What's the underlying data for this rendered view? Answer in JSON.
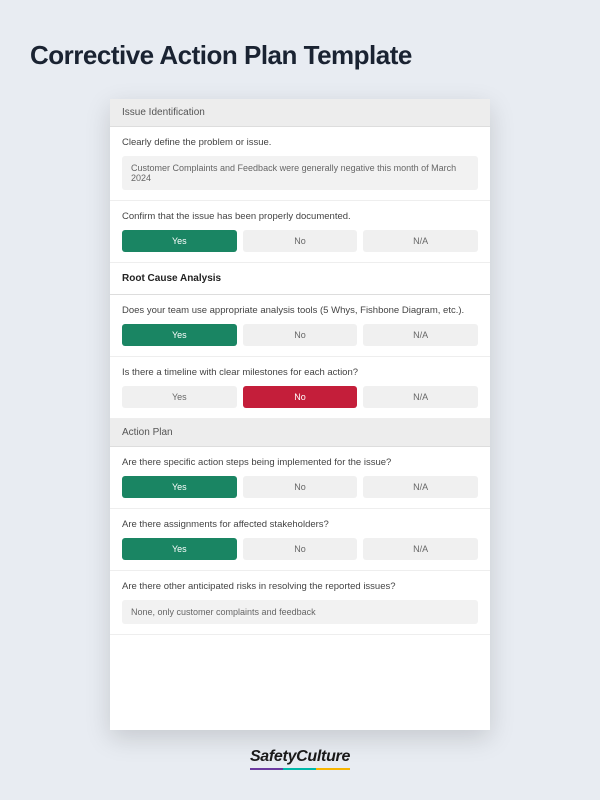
{
  "title": "Corrective Action Plan Template",
  "sections": {
    "issue_identification": {
      "header": "Issue Identification",
      "q1": {
        "text": "Clearly define the problem or issue.",
        "answer": "Customer Complaints and Feedback were generally negative this month of March 2024"
      },
      "q2": {
        "text": "Confirm that the issue has been properly documented.",
        "options": {
          "yes": "Yes",
          "no": "No",
          "na": "N/A"
        },
        "selected": "yes"
      }
    },
    "root_cause": {
      "header": "Root Cause Analysis",
      "q1": {
        "text": "Does your team use appropriate analysis tools (5 Whys, Fishbone Diagram, etc.).",
        "options": {
          "yes": "Yes",
          "no": "No",
          "na": "N/A"
        },
        "selected": "yes"
      },
      "q2": {
        "text": "Is there a timeline with clear milestones for each action?",
        "options": {
          "yes": "Yes",
          "no": "No",
          "na": "N/A"
        },
        "selected": "no"
      }
    },
    "action_plan": {
      "header": "Action Plan",
      "q1": {
        "text": "Are there specific action steps being implemented for the issue?",
        "options": {
          "yes": "Yes",
          "no": "No",
          "na": "N/A"
        },
        "selected": "yes"
      },
      "q2": {
        "text": "Are there assignments for affected stakeholders?",
        "options": {
          "yes": "Yes",
          "no": "No",
          "na": "N/A"
        },
        "selected": "yes"
      },
      "q3": {
        "text": "Are there other anticipated risks in resolving the reported issues?",
        "answer": "None, only customer complaints and feedback"
      }
    }
  },
  "brand": "SafetyCulture"
}
